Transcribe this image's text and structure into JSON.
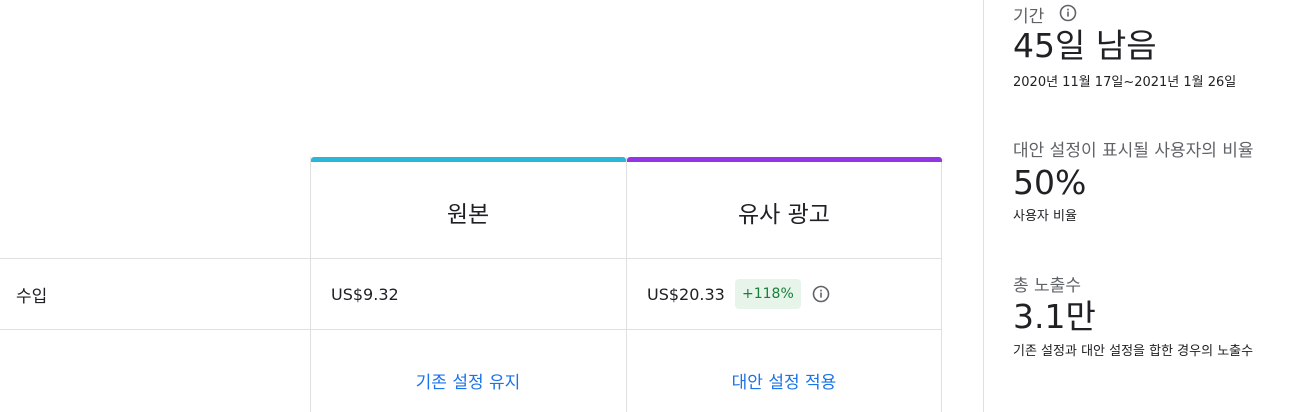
{
  "comparison": {
    "columns": [
      {
        "title": "원본",
        "accent_color": "#29b6d8"
      },
      {
        "title": "유사 광고",
        "accent_color": "#9334e6"
      }
    ],
    "rows": [
      {
        "label": "수입",
        "original_value": "US$9.32",
        "variant_value": "US$20.33",
        "variant_change": "+118%",
        "info_icon": "info-icon"
      }
    ],
    "actions": {
      "keep_original": "기존 설정 유지",
      "apply_variant": "대안 설정 적용"
    }
  },
  "summary": {
    "duration": {
      "label": "기간",
      "info_icon": "info-icon",
      "value": "45일 남음",
      "range": "2020년 11월 17일~2021년 1월 26일"
    },
    "split": {
      "label": "대안 설정이 표시될 사용자의 비율",
      "value": "50%",
      "sub": "사용자 비율"
    },
    "impressions": {
      "label": "총 노출수",
      "value": "3.1만",
      "sub": "기존 설정과 대안 설정을 합한 경우의 노출수"
    }
  },
  "colors": {
    "link": "#1a73e8",
    "positive_badge_bg": "#e6f4ea",
    "positive_badge_text": "#188038",
    "border": "#e0e0e0"
  }
}
